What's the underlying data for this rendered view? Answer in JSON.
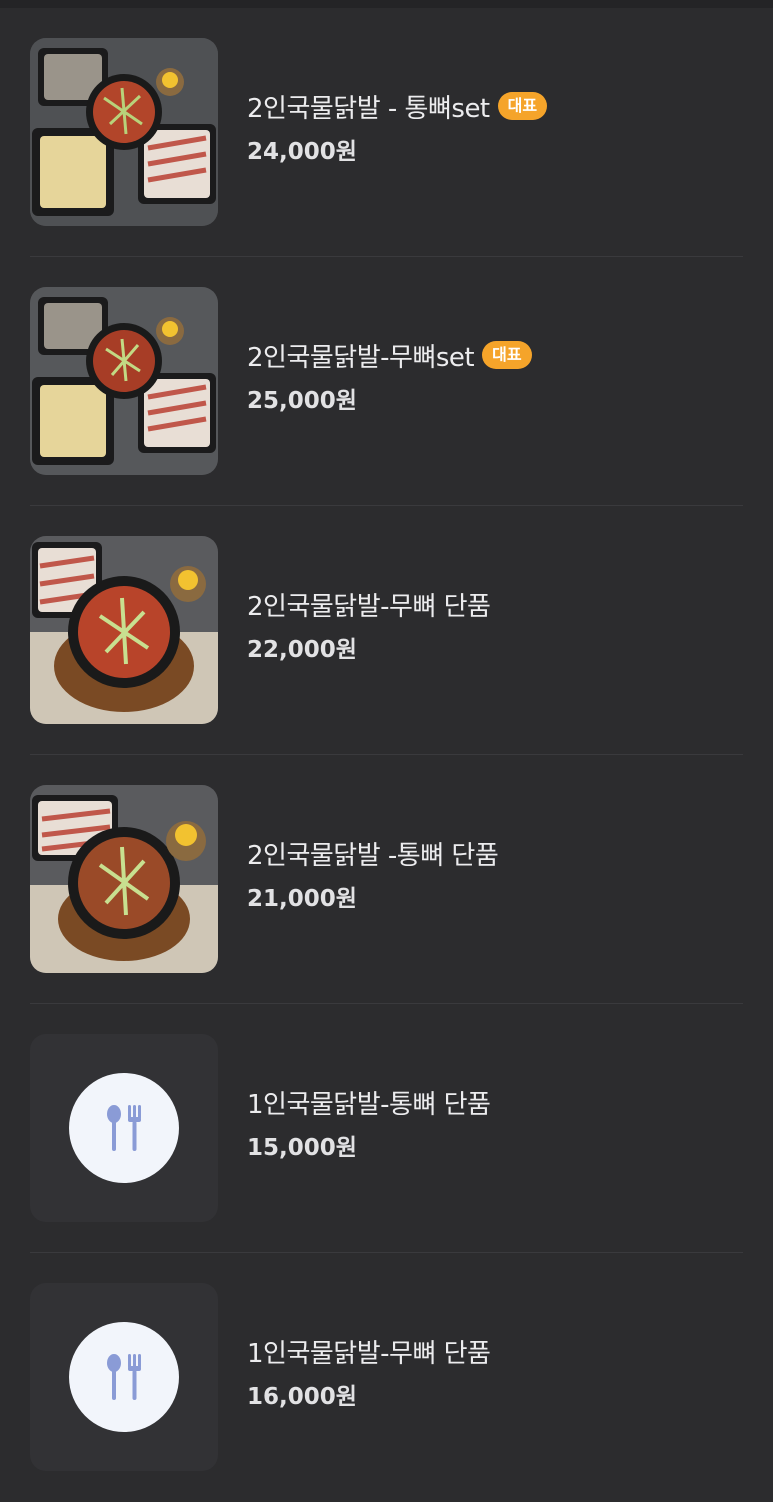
{
  "menu_items": [
    {
      "name": "2인국물닭발 - 통뼈set",
      "badge": "대표",
      "price": "24,000원",
      "image": "set-photo"
    },
    {
      "name": "2인국물닭발-무뼈set",
      "badge": "대표",
      "price": "25,000원",
      "image": "set-photo"
    },
    {
      "name": "2인국물닭발-무뼈 단품",
      "badge": "",
      "price": "22,000원",
      "image": "single-photo"
    },
    {
      "name": "2인국물닭발 -통뼈 단품",
      "badge": "",
      "price": "21,000원",
      "image": "single-photo"
    },
    {
      "name": "1인국물닭발-통뼈 단품",
      "badge": "",
      "price": "15,000원",
      "image": "utensils-placeholder-icon"
    },
    {
      "name": "1인국물닭발-무뼈 단품",
      "badge": "",
      "price": "16,000원",
      "image": "utensils-placeholder-icon"
    }
  ],
  "colors": {
    "background": "#2c2c2e",
    "badge": "#f5a42a",
    "placeholder_icon": "#8a9bd6"
  }
}
